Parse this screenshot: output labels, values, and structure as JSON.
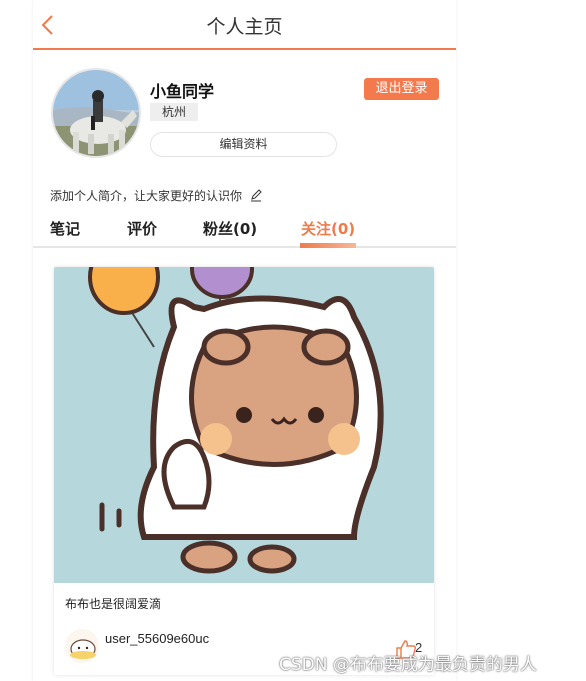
{
  "header": {
    "title": "个人主页",
    "back_icon": "chevron-left-icon"
  },
  "profile": {
    "username": "小鱼同学",
    "city": "杭州",
    "logout_label": "退出登录",
    "edit_label": "编辑资料",
    "bio": "添加个人简介，让大家更好的认识你",
    "bio_icon": "pencil-icon"
  },
  "tabs": [
    {
      "label": "笔记"
    },
    {
      "label": "评价"
    },
    {
      "label": "粉丝(0)"
    },
    {
      "label": "关注(0)",
      "active": true
    }
  ],
  "card": {
    "title": "布布也是很阔爱滴",
    "user": "user_55609e60uc",
    "likes": "2",
    "like_icon": "thumbs-up-icon"
  },
  "watermark": "CSDN @布布要成为最负责的男人",
  "colors": {
    "accent": "#f07a4a",
    "card_bg": "#b6d8dc"
  }
}
